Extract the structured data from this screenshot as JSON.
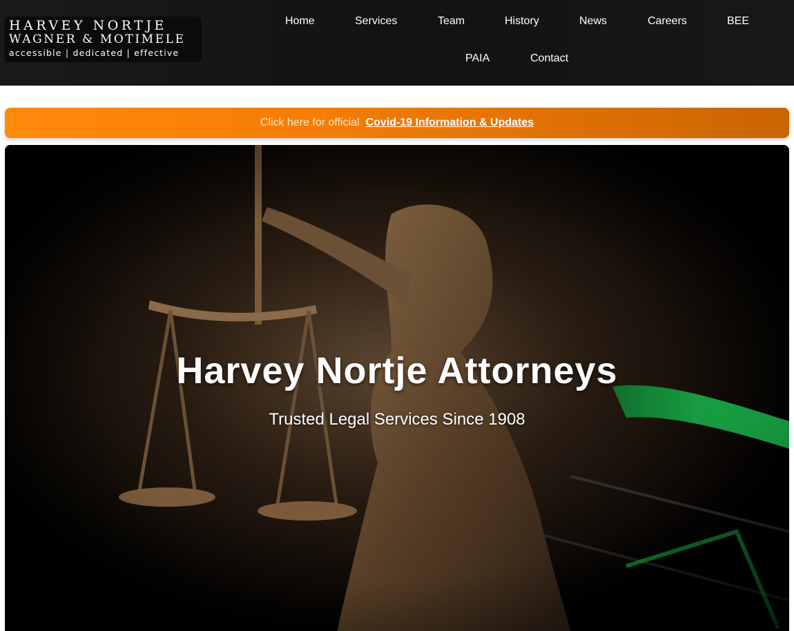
{
  "header": {
    "logo": {
      "line1": "HARVEY NORTJE",
      "line2": "WAGNER & MOTIMELE",
      "tagline": "accessible | dedicated | effective"
    },
    "nav": [
      {
        "label": "Home"
      },
      {
        "label": "Services"
      },
      {
        "label": "Team"
      },
      {
        "label": "History"
      },
      {
        "label": "News"
      },
      {
        "label": "Careers"
      },
      {
        "label": "BEE"
      },
      {
        "label": "PAIA"
      },
      {
        "label": "Contact"
      }
    ]
  },
  "banner": {
    "prefix": "Click here for official",
    "link": "Covid-19 Information & Updates"
  },
  "hero": {
    "title": "Harvey Nortje Attorneys",
    "subtitle": "Trusted Legal Services Since 1908"
  },
  "colors": {
    "header_bg": "#141414",
    "banner_orange": "#f47e06",
    "cart_green": "#1fcf55"
  }
}
